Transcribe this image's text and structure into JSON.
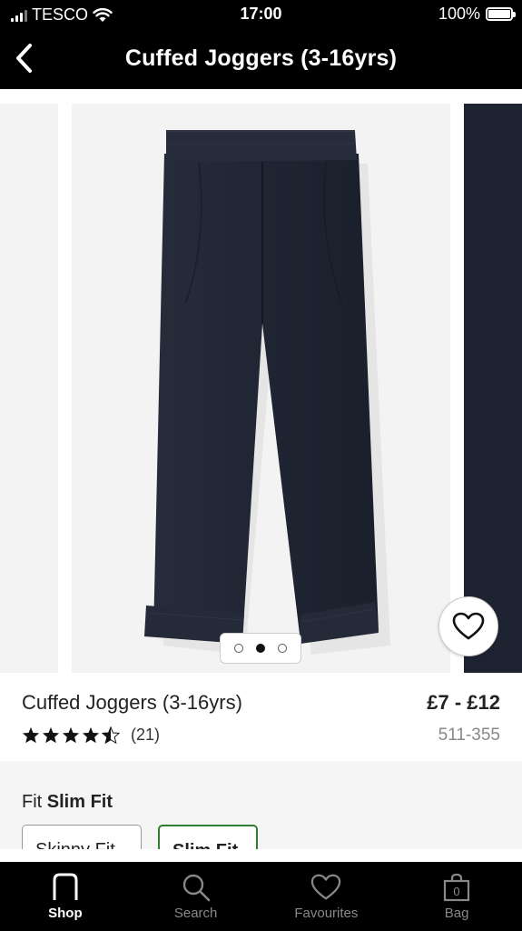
{
  "status_bar": {
    "carrier": "TESCO",
    "time": "17:00",
    "battery": "100%"
  },
  "header": {
    "title": "Cuffed Joggers (3-16yrs)"
  },
  "carousel": {
    "image_count": 3,
    "active_index": 1
  },
  "product": {
    "name": "Cuffed Joggers (3-16yrs)",
    "price": "£7 - £12",
    "rating": 4.5,
    "rating_count": "(21)",
    "code": "511-355"
  },
  "fit": {
    "label": "Fit",
    "selected": "Slim Fit",
    "options": [
      "Skinny Fit",
      "Slim Fit"
    ]
  },
  "tab_bar": {
    "tabs": [
      {
        "label": "Shop",
        "icon": "next-logo-icon"
      },
      {
        "label": "Search",
        "icon": "search-icon"
      },
      {
        "label": "Favourites",
        "icon": "heart-icon"
      },
      {
        "label": "Bag",
        "icon": "bag-icon"
      }
    ],
    "bag_count": "0"
  },
  "colors": {
    "accent_selected_border": "#2e7d32",
    "header_bg": "#000000",
    "product_fabric": "#1f2533"
  }
}
